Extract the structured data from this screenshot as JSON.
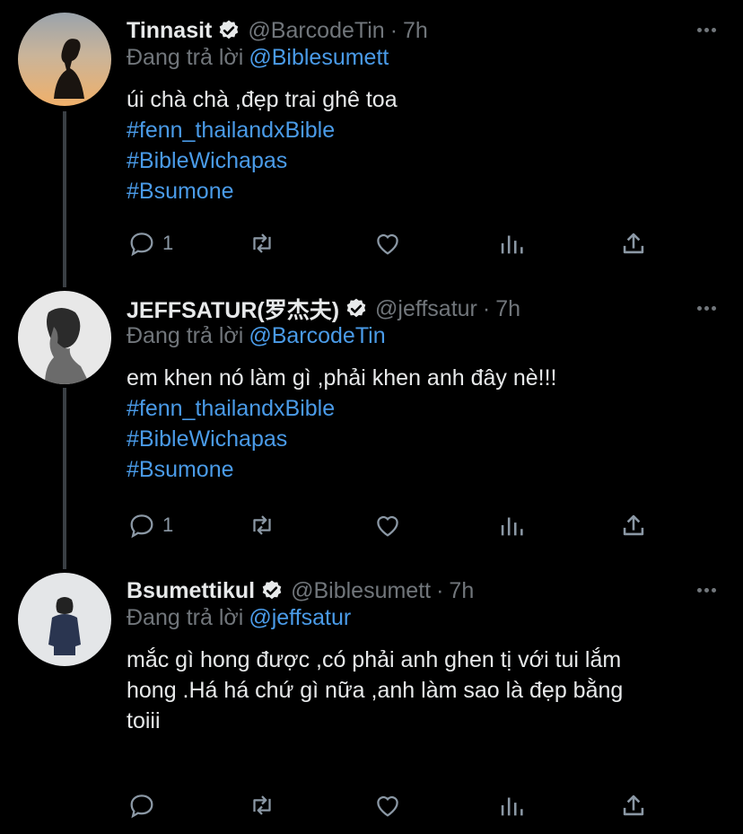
{
  "colors": {
    "background": "#000000",
    "text": "#e7e9ea",
    "muted": "#71767b",
    "link": "#4a9be8",
    "thread_line": "#3a3f44"
  },
  "icons": {
    "verified": "verified-badge-icon",
    "reply": "reply-icon",
    "retweet": "retweet-icon",
    "like": "like-icon",
    "views": "views-icon",
    "share": "share-icon",
    "more": "more-icon"
  },
  "tweets": [
    {
      "name": "Tinnasit",
      "handle": "@BarcodeTin",
      "separator": "·",
      "time": "7h",
      "reply_prefix": "Đang trả lời",
      "reply_to": "@Biblesumett",
      "text": "úi chà chà ,đẹp trai ghê toa",
      "hashtags": [
        "#fenn_thailandxBible",
        "#BibleWichapas",
        "#Bsumone"
      ],
      "reply_count": "1"
    },
    {
      "name": "JEFFSATUR(罗杰夫)",
      "handle": "@jeffsatur",
      "separator": "·",
      "time": "7h",
      "reply_prefix": "Đang trả lời",
      "reply_to": "@BarcodeTin",
      "text": "em khen nó làm gì ,phải khen anh đây nè!!!",
      "hashtags": [
        "#fenn_thailandxBible",
        "#BibleWichapas",
        "#Bsumone"
      ],
      "reply_count": "1"
    },
    {
      "name": "Bsumettikul",
      "handle": "@Biblesumett",
      "separator": "·",
      "time": "7h",
      "reply_prefix": "Đang trả lời",
      "reply_to": "@jeffsatur",
      "text_lines": [
        "mắc gì hong được ,có phải anh ghen tị với tui lắm",
        "hong .Há há chứ gì nữa ,anh làm sao là đẹp bằng",
        "toiii"
      ],
      "reply_count": ""
    }
  ]
}
